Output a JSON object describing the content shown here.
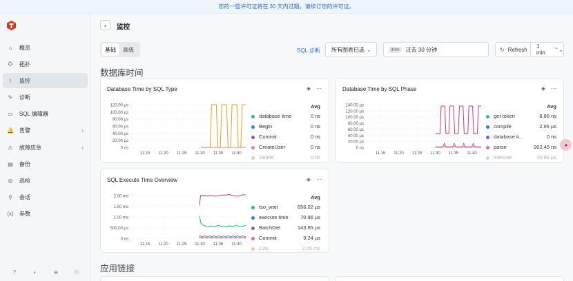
{
  "banner": {
    "text_before": "您的一些许可证将在 30 天内过期。请",
    "link": "续订您的许可证",
    "text_after": "。"
  },
  "sidebar": {
    "items": [
      {
        "label": "概览",
        "icon": "home-icon",
        "glyph": "⌂"
      },
      {
        "label": "拓扑",
        "icon": "topology-icon",
        "glyph": "⛭"
      },
      {
        "label": "监控",
        "icon": "monitor-icon",
        "glyph": "⌇"
      },
      {
        "label": "诊断",
        "icon": "diagnose-icon",
        "glyph": "✎"
      },
      {
        "label": "SQL 编辑器",
        "icon": "sql-editor-icon",
        "glyph": "▭"
      },
      {
        "label": "告警",
        "icon": "alert-icon",
        "glyph": "🔔"
      },
      {
        "label": "故障应急",
        "icon": "emergency-icon",
        "glyph": "⚠"
      },
      {
        "label": "备份",
        "icon": "backup-icon",
        "glyph": "▤"
      },
      {
        "label": "巡检",
        "icon": "inspection-icon",
        "glyph": "◎"
      },
      {
        "label": "会话",
        "icon": "session-icon",
        "glyph": "⚲"
      },
      {
        "label": "参数",
        "icon": "params-icon",
        "glyph": "(x)"
      }
    ],
    "active": "监控"
  },
  "header": {
    "title": "监控"
  },
  "toolbar": {
    "tab_basic": "基础",
    "tab_advanced": "高级",
    "sql_diag": "SQL 诊断",
    "chart_select": "所有图表已选",
    "time_tag": "30m",
    "time_range": "过去 30 分钟",
    "refresh": "Refresh",
    "interval": "1 min"
  },
  "sections": {
    "db_time": "数据库时间",
    "app_link": "应用链接"
  },
  "cards": {
    "c1": {
      "title": "Database Time by SQL Type",
      "avg": "Avg",
      "legend": [
        {
          "name": "database time",
          "value": "0 ns",
          "color": "#2fb58a"
        },
        {
          "name": "Begin",
          "value": "0 ns",
          "color": "#3a78d6"
        },
        {
          "name": "Commit",
          "value": "0 ns",
          "color": "#8a55c9"
        },
        {
          "name": "CreateUser",
          "value": "0 ns",
          "color": "#e77fa8"
        },
        {
          "name": "Delete",
          "value": "0 ns",
          "color": "#e06a3a"
        }
      ]
    },
    "c2": {
      "title": "Database Time by SQL Phase",
      "avg": "Avg",
      "legend": [
        {
          "name": "get token",
          "value": "8.86 ns",
          "color": "#2fb58a"
        },
        {
          "name": "compile",
          "value": "2.95 µs",
          "color": "#3a78d6"
        },
        {
          "name": "database ti...",
          "value": "0 ns",
          "color": "#8a55c9"
        },
        {
          "name": "parse",
          "value": "902.45 ns",
          "color": "#e06a9a"
        },
        {
          "name": "execute",
          "value": "70.96 µs",
          "color": "#e06a3a"
        }
      ]
    },
    "c3": {
      "title": "SQL Execute Time Overview",
      "avg": "Avg",
      "legend": [
        {
          "name": "tso_wait",
          "value": "656.02 µs",
          "color": "#2fb58a"
        },
        {
          "name": "execute time",
          "value": "70.96 µs",
          "color": "#3a78d6"
        },
        {
          "name": "BatchGet",
          "value": "143.85 µs",
          "color": "#8a55c9"
        },
        {
          "name": "Commit",
          "value": "9.24 µs",
          "color": "#e06a9a"
        },
        {
          "name": "Cop",
          "value": "2.05 ms",
          "color": "#e06a3a"
        }
      ]
    }
  },
  "chart_data": [
    {
      "type": "line",
      "title": "Database Time by SQL Type",
      "y_ticks": [
        "120.00 µs",
        "100.00 µs",
        "80.00 µs",
        "60.00 µs",
        "40.00 µs",
        "20.00 µs",
        "0 ns"
      ],
      "x_ticks": [
        "11:15",
        "11:20",
        "11:25",
        "11:30",
        "11:35",
        "11:40"
      ],
      "ylim": [
        0,
        120
      ],
      "series": [
        {
          "name": "database time",
          "color": "#d6a625",
          "x": [
            11.45,
            11.54,
            11.58,
            11.63,
            11.67,
            11.72
          ],
          "values": [
            0,
            0,
            0,
            0,
            0,
            0
          ]
        }
      ],
      "pulses": [
        [
          11.54,
          11.58
        ],
        [
          11.63,
          11.67
        ],
        [
          11.72,
          11.76
        ],
        [
          11.81,
          11.85
        ],
        [
          11.9,
          11.94
        ]
      ],
      "pulse_value": 120,
      "x_range": [
        11.1,
        12.0
      ]
    },
    {
      "type": "line",
      "title": "Database Time by SQL Phase",
      "y_ticks": [
        "140.00 µs",
        "120.00 µs",
        "100.00 µs",
        "80.00 µs",
        "60.00 µs",
        "40.00 µs",
        "20.00 µs",
        "0 ns"
      ],
      "x_ticks": [
        "11:15",
        "11:20",
        "11:25",
        "11:30",
        "11:35",
        "11:40"
      ],
      "ylim": [
        0,
        140
      ]
    },
    {
      "type": "line",
      "title": "SQL Execute Time Overview",
      "y_ticks": [
        "2.00 ms",
        "1.50 ms",
        "1.00 ms",
        "500.00 µs",
        "0 ns"
      ],
      "x_ticks": [
        "11:15",
        "11:20",
        "11:25",
        "11:30",
        "11:35",
        "11:40"
      ],
      "ylim": [
        0,
        2
      ]
    }
  ],
  "side_bottom": [
    {
      "icon": "help-icon",
      "glyph": "?"
    },
    {
      "icon": "theme-icon",
      "glyph": "◐"
    },
    {
      "icon": "language-icon",
      "glyph": "⊕"
    },
    {
      "icon": "user-icon",
      "glyph": "⚇"
    }
  ],
  "float_chat": {
    "icon": "chat-assistant-icon",
    "glyph": "◕"
  }
}
